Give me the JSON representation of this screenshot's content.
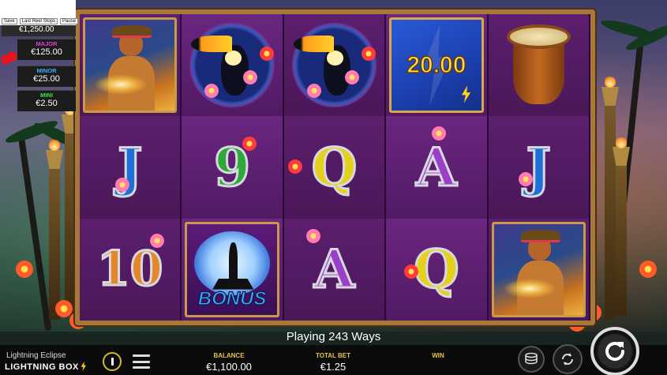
{
  "game": {
    "title": "Lightning Eclipse",
    "brand": "LIGHTNING BOX",
    "ways_text": "Playing 243 Ways"
  },
  "top_controls": {
    "save": "Save",
    "last_reel_stops": "Last Reel Stops",
    "pause": "Pause"
  },
  "jackpots": {
    "grand_value": "€1,250.00",
    "major_label": "MAJOR",
    "major_value": "€125.00",
    "minor_label": "MINOR",
    "minor_value": "€25.00",
    "mini_label": "MINI",
    "mini_value": "€2.50",
    "colors": {
      "major": "#e040d0",
      "minor": "#3ab0ff",
      "mini": "#3fe04a"
    }
  },
  "reels": [
    [
      "fire-dancer",
      "J",
      "10"
    ],
    [
      "toucan",
      "9",
      "bonus"
    ],
    [
      "toucan",
      "Q",
      "A"
    ],
    [
      "lightning-bolt",
      "A",
      "Q"
    ],
    [
      "drum",
      "J",
      "fire-dancer"
    ]
  ],
  "bolt_value": "20.00",
  "bonus_label": "BONUS",
  "stats": {
    "balance_label": "BALANCE",
    "balance_value": "€1,100.00",
    "total_bet_label": "TOTAL BET",
    "total_bet_value": "€1.25",
    "win_label": "WIN",
    "win_value": ""
  },
  "icons": {
    "power": "power-icon",
    "menu": "menu-icon",
    "coins": "coin-stack-icon",
    "autoplay": "autoplay-icon",
    "spin": "spin-icon"
  }
}
